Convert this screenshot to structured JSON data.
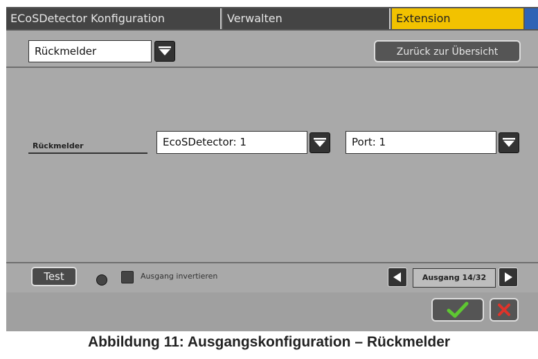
{
  "tabs": [
    {
      "label": "ECoSDetector Konfiguration",
      "active": false
    },
    {
      "label": "Verwalten",
      "active": false
    },
    {
      "label": "Extension",
      "active": true
    }
  ],
  "type_select": {
    "value": "Rückmelder"
  },
  "overview_button": {
    "label": "Zurück zur Übersicht"
  },
  "field": {
    "label": "Rückmelder",
    "detector_select": {
      "value": "EcoSDetector: 1"
    },
    "port_select": {
      "value": "Port: 1"
    }
  },
  "actions": {
    "test_label": "Test",
    "invert_label": "Ausgang invertieren",
    "invert_checked": false,
    "output_indicator": "Ausgang 14/32"
  },
  "confirm": {
    "ok_icon": "checkmark-icon",
    "cancel_icon": "x-icon"
  },
  "caption": "Abbildung 11: Ausgangskonfiguration – Rückmelder",
  "colors": {
    "active_tab": "#f2c200",
    "tab_bg": "#444444",
    "panel_bg": "#a9a9a9",
    "ok_check": "#5ec732",
    "cancel_x": "#e0332a"
  }
}
